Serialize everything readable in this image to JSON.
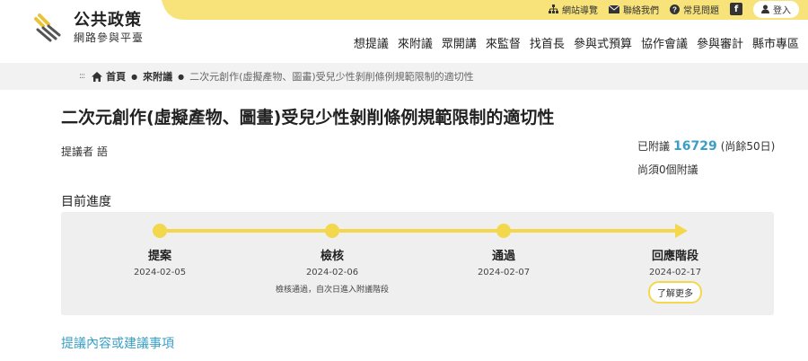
{
  "site": {
    "title": "公共政策",
    "subtitle": "網路參與平臺"
  },
  "topbar": {
    "sitemap": "網站導覽",
    "contact": "聯絡我們",
    "faq": "常見問題",
    "facebook": "f",
    "login": "登入"
  },
  "nav": {
    "items": [
      "想提議",
      "來附議",
      "眾開講",
      "來監督",
      "找首長",
      "參與式預算",
      "協作會議",
      "參與審計",
      "縣市專區"
    ]
  },
  "breadcrumb": {
    "dots": ":::",
    "home": "首頁",
    "section": "來附議",
    "current": "二次元創作(虛擬產物、圖畫)受兒少性剝削條例規範限制的適切性"
  },
  "proposal": {
    "title": "二次元創作(虛擬產物、圖畫)受兒少性剝削條例規範限制的適切性",
    "proposer": "提議者 語",
    "endorse_prefix": "已附議",
    "endorse_count": "16729",
    "endorse_remaining": "(尚餘50日)",
    "need_more": "尚須0個附議"
  },
  "progress": {
    "heading": "目前進度",
    "stages": [
      {
        "label": "提案",
        "date": "2024-02-05",
        "note": ""
      },
      {
        "label": "檢核",
        "date": "2024-02-06",
        "note": "檢核通過，自次日進入附議階段"
      },
      {
        "label": "通過",
        "date": "2024-02-07",
        "note": ""
      },
      {
        "label": "回應階段",
        "date": "2024-02-17",
        "note": ""
      }
    ],
    "learn_more": "了解更多"
  },
  "content_section": {
    "heading": "提議內容或建議事項"
  },
  "colors": {
    "header_yellow": "#f7e37a",
    "track_yellow": "#f3d84d",
    "accent_blue": "#3a9fc6",
    "breadcrumb_bg": "#f2f2f2",
    "progress_bg": "#efefef"
  }
}
